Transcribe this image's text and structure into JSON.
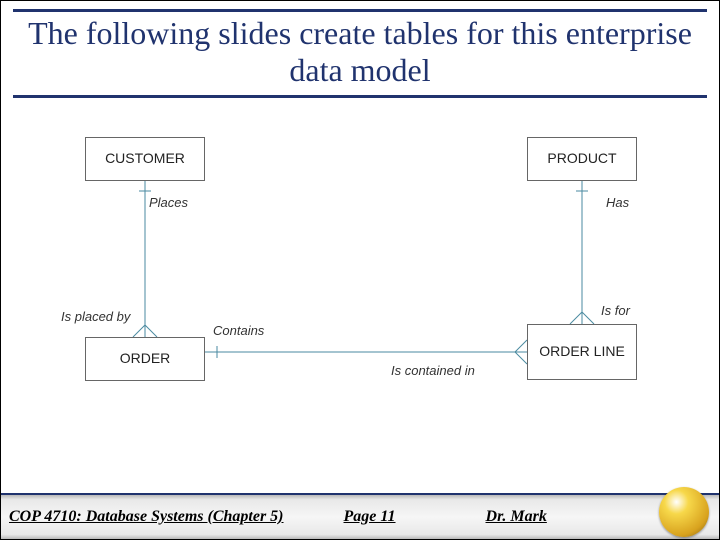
{
  "title": "The following slides create tables for this enterprise data model",
  "entities": {
    "customer": "CUSTOMER",
    "product": "PRODUCT",
    "order": "ORDER",
    "orderline": "ORDER LINE"
  },
  "relationships": {
    "places": "Places",
    "has": "Has",
    "is_placed_by": "Is placed by",
    "is_for": "Is for",
    "contains": "Contains",
    "is_contained_in": "Is contained in"
  },
  "footer": {
    "course": "COP 4710: Database Systems  (Chapter 5)",
    "page": "Page 11",
    "author": "Dr. Mark"
  }
}
